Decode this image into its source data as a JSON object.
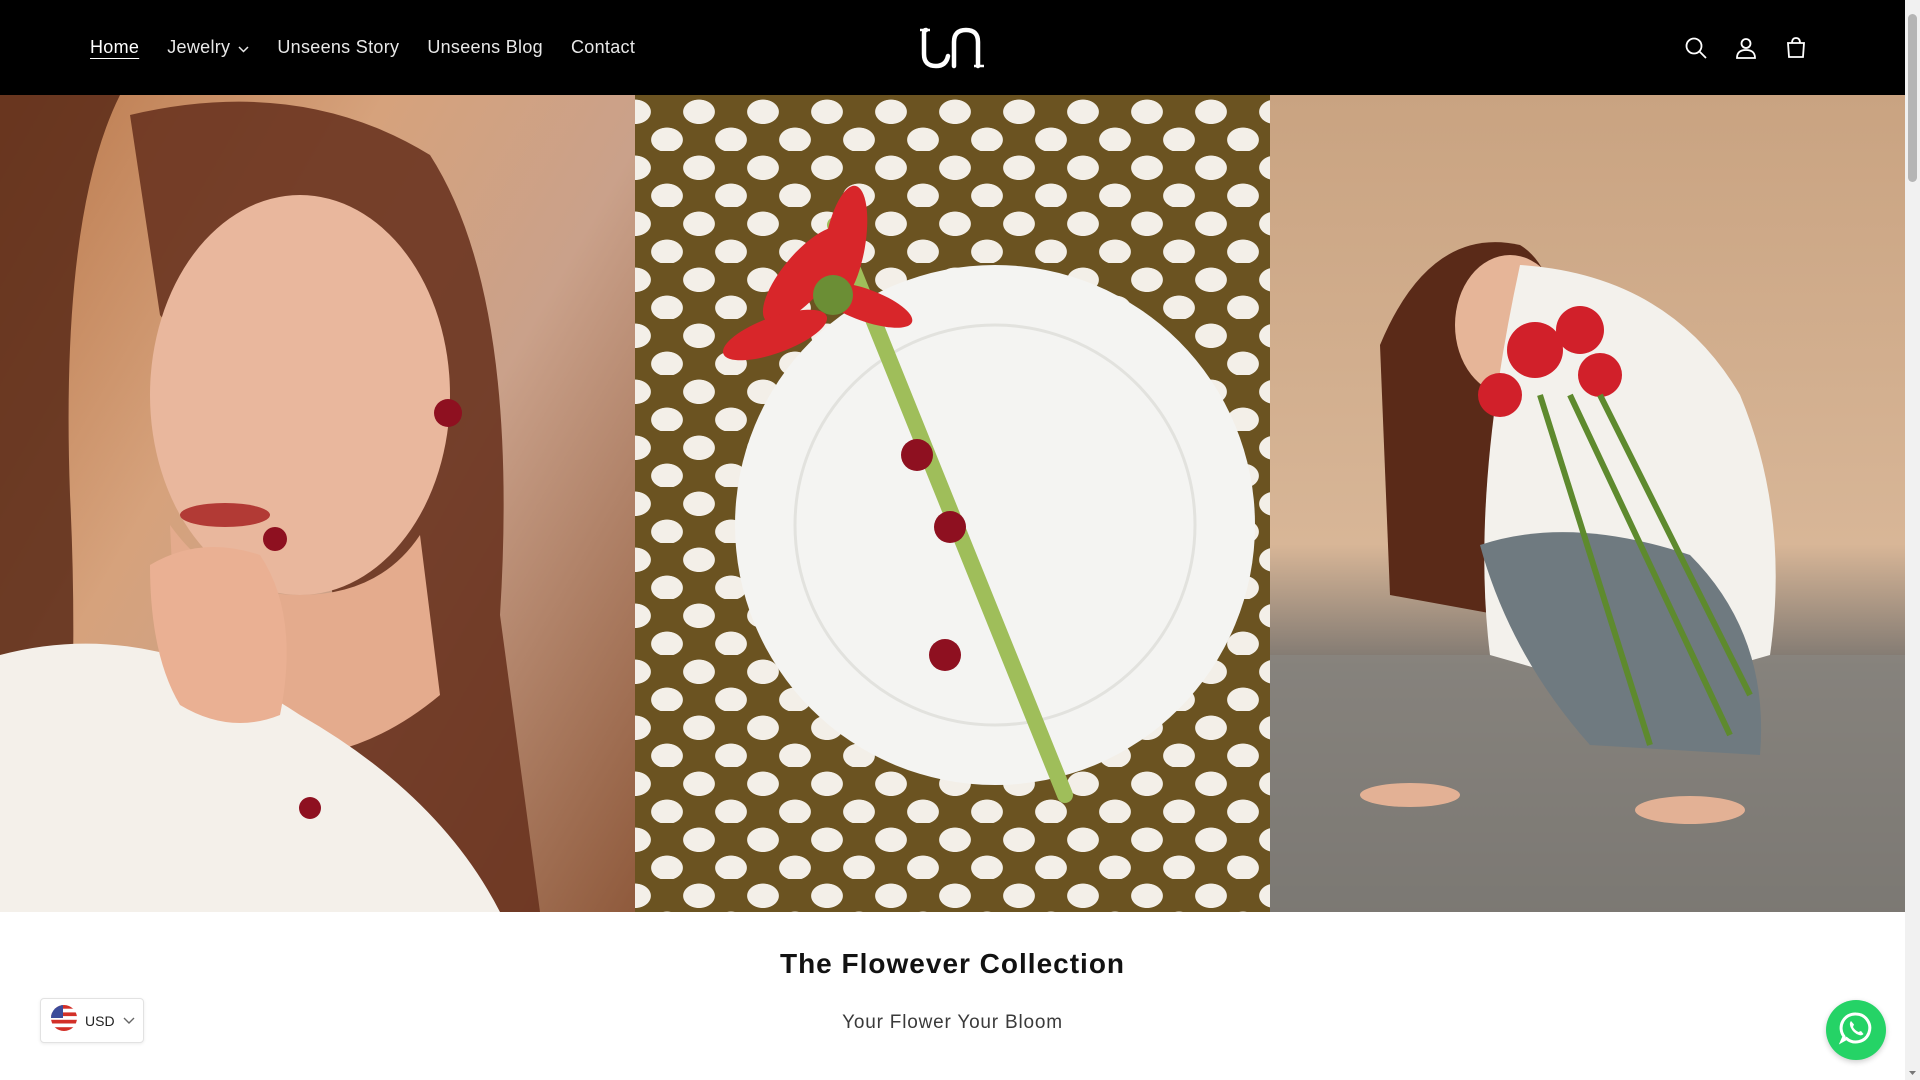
{
  "header": {
    "nav": [
      {
        "label": "Home",
        "active": true
      },
      {
        "label": "Jewelry",
        "has_dropdown": true
      },
      {
        "label": "Unseens Story"
      },
      {
        "label": "Unseens Blog"
      },
      {
        "label": "Contact"
      }
    ],
    "logo_text": "Un",
    "icons": [
      "search-icon",
      "account-icon",
      "cart-icon"
    ]
  },
  "hero": {
    "panels": [
      {
        "description_icon": "model-portrait-image"
      },
      {
        "description_icon": "plate-flower-image"
      },
      {
        "description_icon": "model-flowers-image"
      }
    ]
  },
  "collection": {
    "title": "The Flowever Collection",
    "subtitle": "Your Flower Your Bloom"
  },
  "currency": {
    "selected": "USD",
    "flag_icon": "us-flag-icon"
  },
  "colors": {
    "header_bg": "#000000",
    "whatsapp": "#25d366"
  }
}
